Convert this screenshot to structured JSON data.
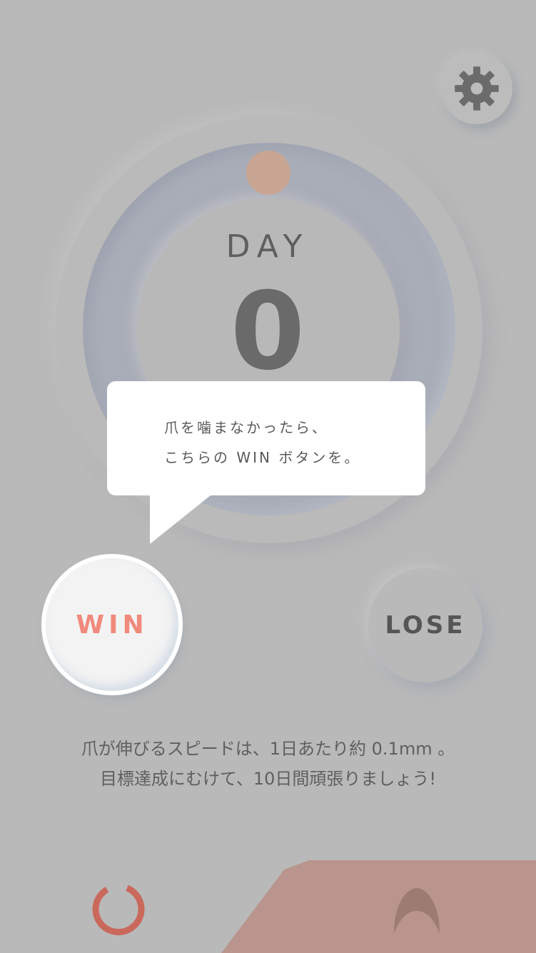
{
  "day": {
    "label": "DAY",
    "count": "0"
  },
  "progress": {
    "color": "#c9a693"
  },
  "tooltip": {
    "line1": "爪を噛まなかったら、",
    "line2": "こちらの WIN ボタンを。"
  },
  "buttons": {
    "win_label": "WIN",
    "lose_label": "LOSE",
    "win_color": "#f08a7c"
  },
  "info": {
    "line1": "爪が伸びるスピードは、1日あたり約 0.1mm 。",
    "line2": "目標達成にむけて、10日間頑張りましょう!"
  },
  "icons": {
    "settings": "gear-icon",
    "reset": "refresh-icon",
    "nail": "nail-icon"
  },
  "colors": {
    "background": "#b9b9b9",
    "accent": "#c9695c",
    "bottom_tab": "#b9958d",
    "nail_icon": "#9d7b73"
  }
}
